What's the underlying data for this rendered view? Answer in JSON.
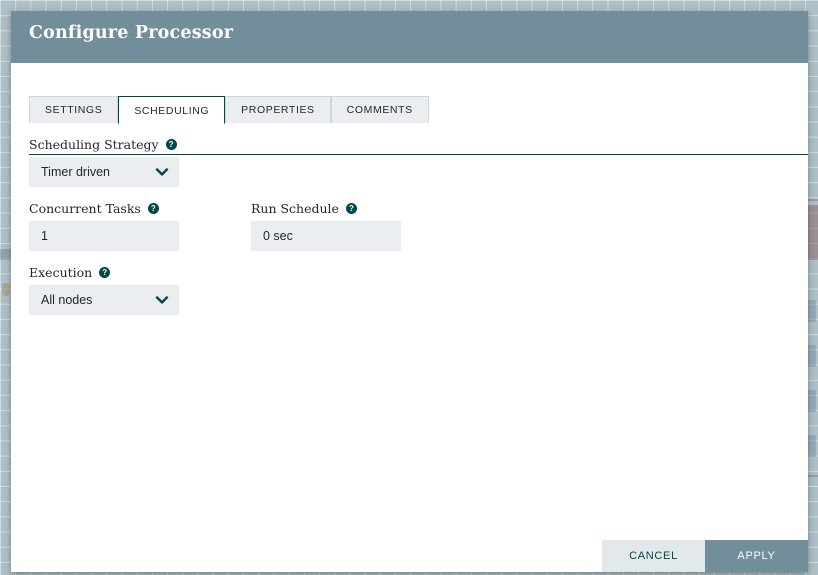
{
  "dialog": {
    "title": "Configure Processor",
    "tabs": [
      {
        "label": "SETTINGS",
        "active": false
      },
      {
        "label": "SCHEDULING",
        "active": true
      },
      {
        "label": "PROPERTIES",
        "active": false
      },
      {
        "label": "COMMENTS",
        "active": false
      }
    ],
    "fields": {
      "scheduling_strategy": {
        "label": "Scheduling Strategy",
        "help": "?",
        "value": "Timer driven",
        "type": "select"
      },
      "concurrent_tasks": {
        "label": "Concurrent Tasks",
        "help": "?",
        "value": "1",
        "type": "text"
      },
      "run_schedule": {
        "label": "Run Schedule",
        "help": "?",
        "value": "0 sec",
        "type": "text"
      },
      "execution": {
        "label": "Execution",
        "help": "?",
        "value": "All nodes",
        "type": "select"
      }
    },
    "footer": {
      "cancel_label": "CANCEL",
      "apply_label": "APPLY"
    }
  },
  "colors": {
    "header_bg": "#728e9b",
    "accent": "#004849",
    "input_bg": "#eaeef0",
    "tab_inactive_bg": "#eaeef0",
    "apply_bg": "#728e9b",
    "cancel_bg": "#e3e8eb",
    "canvas_bg": "#aebfc6"
  },
  "icons": {
    "help": "help-circle-icon",
    "chevron": "chevron-down-icon"
  }
}
